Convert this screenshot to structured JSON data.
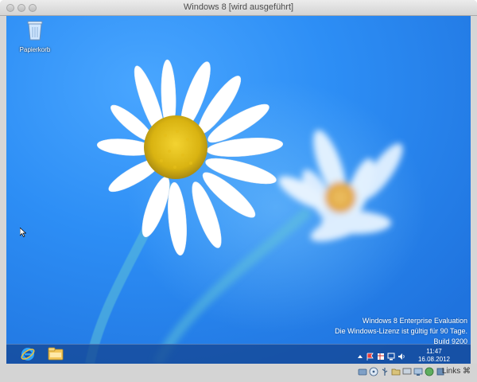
{
  "window": {
    "title": "Windows 8 [wird ausgeführt]"
  },
  "desktop": {
    "icons": [
      {
        "label": "Papierkorb",
        "icon": "recycle-bin-icon"
      }
    ],
    "watermark": {
      "line1": "Windows 8 Enterprise Evaluation",
      "line2": "Die Windows-Lizenz ist gültig für 90 Tage.",
      "line3": "Build 9200"
    }
  },
  "taskbar": {
    "pinned": [
      {
        "name": "Internet Explorer",
        "icon": "internet-explorer-icon"
      },
      {
        "name": "Explorer",
        "icon": "file-explorer-icon"
      }
    ],
    "tray_icons": [
      "show-hidden-icons-icon",
      "action-center-flag-icon",
      "security-icon",
      "network-icon",
      "volume-icon"
    ],
    "clock": {
      "time": "11:47",
      "date": "16.08.2012"
    }
  },
  "statusbar": {
    "icons": [
      "hard-disk-icon",
      "cd-icon",
      "usb-icon",
      "shared-folder-icon",
      "network-adapter-icon",
      "display-icon",
      "recording-icon",
      "cpu-icon"
    ],
    "host_key": "Links ⌘"
  },
  "colors": {
    "wallpaper": "#2d8ef5",
    "taskbar": "#1448a0"
  }
}
